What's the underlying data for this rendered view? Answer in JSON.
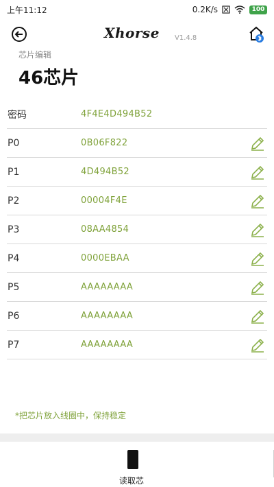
{
  "status_bar": {
    "time": "上午11:12",
    "speed": "0.2K/s",
    "battery": "100"
  },
  "header": {
    "logo": "Xhorse",
    "version": "V1.4.8"
  },
  "subtitle": "芯片编辑",
  "title": "46芯片",
  "rows": [
    {
      "label": "密码",
      "value": "4F4E4D494B52",
      "editable": false
    },
    {
      "label": "P0",
      "value": "0B06F822",
      "editable": true
    },
    {
      "label": "P1",
      "value": "4D494B52",
      "editable": true
    },
    {
      "label": "P2",
      "value": "00004F4E",
      "editable": true
    },
    {
      "label": "P3",
      "value": "08AA4854",
      "editable": true
    },
    {
      "label": "P4",
      "value": "0000EBAA",
      "editable": true
    },
    {
      "label": "P5",
      "value": "AAAAAAAA",
      "editable": true
    },
    {
      "label": "P6",
      "value": "AAAAAAAA",
      "editable": true
    },
    {
      "label": "P7",
      "value": "AAAAAAAA",
      "editable": true
    }
  ],
  "hint": "*把芯片放入线圈中，保持稳定",
  "bottom": {
    "read_label": "读取芯"
  },
  "colors": {
    "value_green": "#7fa23a",
    "battery_green": "#3fa34a"
  },
  "icons": {
    "back": "back-circle-arrow-icon",
    "home": "home-bluetooth-icon",
    "edit": "pencil-icon"
  }
}
